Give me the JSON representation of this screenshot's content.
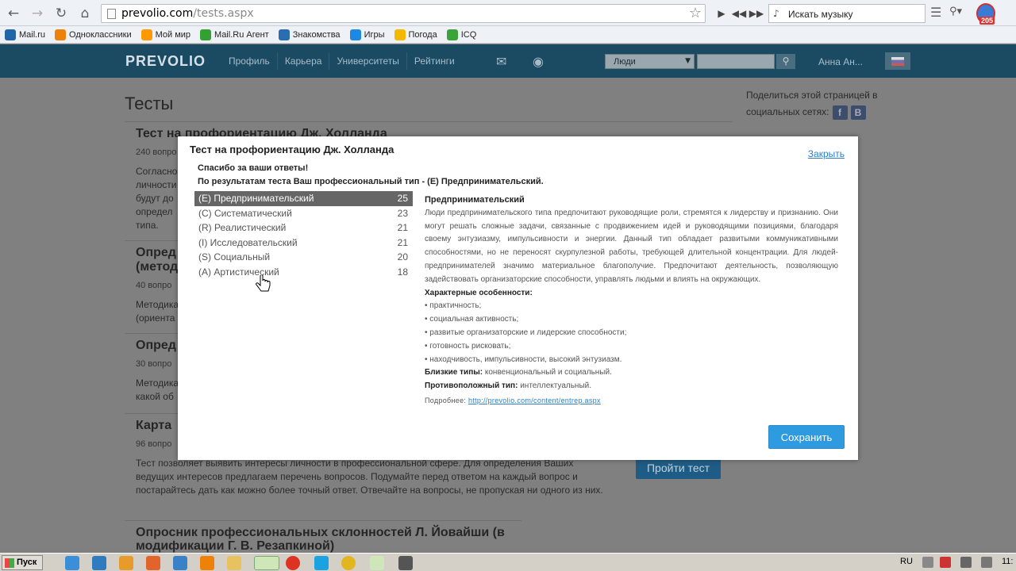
{
  "browser": {
    "url_host": "prevolio.com",
    "url_path": "/tests.aspx",
    "music_search_placeholder": "Искать музыку",
    "extension_badge": "205"
  },
  "bookmarks": [
    {
      "label": "Mail.ru",
      "color": "#2266aa"
    },
    {
      "label": "Одноклассники",
      "color": "#ee8208"
    },
    {
      "label": "Мой мир",
      "color": "#ff9900"
    },
    {
      "label": "Mail.Ru Агент",
      "color": "#33a033"
    },
    {
      "label": "Знакомства",
      "color": "#2a6db2"
    },
    {
      "label": "Игры",
      "color": "#1e88e5"
    },
    {
      "label": "Погода",
      "color": "#f5b800"
    },
    {
      "label": "ICQ",
      "color": "#3aa43a"
    }
  ],
  "header": {
    "logo": "PREVOLIO",
    "nav": [
      "Профиль",
      "Карьера",
      "Университеты",
      "Рейтинги"
    ],
    "people_select": "Люди",
    "user_name": "Анна Ан..."
  },
  "page": {
    "title": "Тесты",
    "share_text_1": "Поделиться этой страницей в",
    "share_text_2": "социальных сетях:",
    "tests": [
      {
        "title": "Тест на профориентацию Дж. Холланда",
        "count": "240 вопро",
        "desc": "Согласно|личности|будут до|определ|типа."
      },
      {
        "title": "Опред|(метод",
        "count": "40 вопро",
        "desc": "Методика|(ориента"
      },
      {
        "title": "Опред",
        "count": "30 вопро",
        "desc": "Методика|какой об"
      },
      {
        "title": "Карта",
        "count": "96 вопро",
        "desc": "Тест позволяет выявить интересы личности в профессиональной сфере. Для определения Ваших ведущих интересов предлагаем перечень вопросов. Подумайте перед ответом на каждый вопрос и постарайтесь дать как можно более точный ответ. Отвечайте на вопросы, не пропуская ни одного из них."
      },
      {
        "title": "Опросник профессиональных склонностей Л. Йовайши (в модификации Г. В. Резапкиной)",
        "count": "",
        "desc": ""
      }
    ],
    "take_test_label": "Пройти тест"
  },
  "modal": {
    "title": "Тест на профориентацию Дж. Холланда",
    "close_label": "Закрыть",
    "thanks": "Спасибо за ваши ответы!",
    "result_line": "По результатам теста Ваш профессиональный тип - (E) Предпринимательский.",
    "results": [
      {
        "label": "(E) Предпринимательский",
        "score": "25",
        "active": true
      },
      {
        "label": "(C) Систематический",
        "score": "23",
        "active": false
      },
      {
        "label": "(R) Реалистический",
        "score": "21",
        "active": false
      },
      {
        "label": "(I) Исследовательский",
        "score": "21",
        "active": false
      },
      {
        "label": "(S) Социальный",
        "score": "20",
        "active": false
      },
      {
        "label": "(A) Артистический",
        "score": "18",
        "active": false
      }
    ],
    "detail": {
      "heading": "Предпринимательский",
      "text": "Люди предпринимательского типа предпочитают руководящие роли, стремятся к лидерству и признанию. Они могут решать сложные задачи, связанные с продвижением идей и руководящими позициями, благодаря своему энтузиазму, импульсивности и энергии. Данный тип обладает развитыми коммуникативными способностями, но не переносят скурпулезной работы, требующей длительной концентрации. Для людей-предпринимателей значимо материальное благополучие. Предпочитают деятельность, позволяющую задействовать организаторские способности, управлять людьми и влиять на окружающих.",
      "features_label": "Характерные особенности:",
      "features": [
        "• практичность;",
        "• социальная активность;",
        "• развитые организаторские и лидерские способности;",
        "• готовность рисковать;",
        "• находчивость, импульсивности, высокий энтузиазм."
      ],
      "close_types_label": "Близкие типы:",
      "close_types": " конвенциональный и социальный.",
      "opposite_label": "Противоположный тип:",
      "opposite": " интеллектуальный.",
      "more_label": "Подробнее: ",
      "more_link": "http://prevolio.com/content/entrep.aspx"
    },
    "save_label": "Сохранить"
  },
  "taskbar": {
    "start_label": "Пуск",
    "lang": "RU",
    "time": "11:"
  }
}
